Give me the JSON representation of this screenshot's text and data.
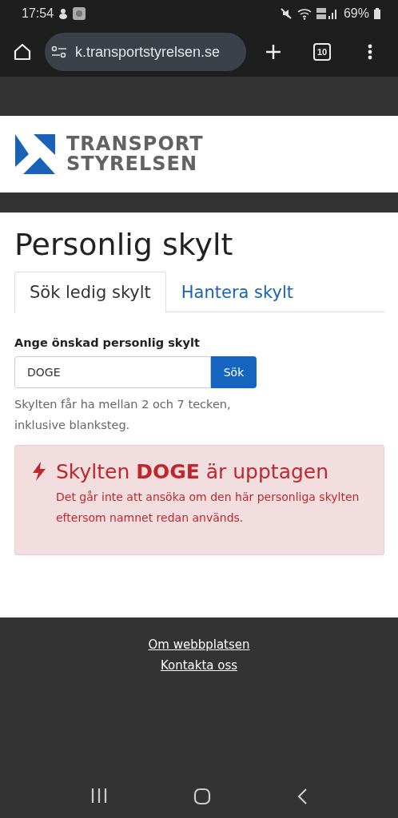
{
  "status_bar": {
    "time": "17:54",
    "battery": "69%"
  },
  "browser": {
    "url": "k.transportstyrelsen.se",
    "tab_count": "10"
  },
  "logo": {
    "line_1": "TRANSPORT",
    "line_2": "STYRELSEN"
  },
  "page": {
    "title": "Personlig skylt"
  },
  "tabs": [
    {
      "label": "Sök ledig skylt",
      "selected": true
    },
    {
      "label": "Hantera skylt",
      "selected": false
    }
  ],
  "form": {
    "label": "Ange önskad personlig skylt",
    "value": "DOGE",
    "button": "Sök",
    "hint": "Skylten får ha mellan 2 och 7 tecken, inklusive blanksteg."
  },
  "alert": {
    "title": "Skylten **DOGE** är upptagen",
    "message": "Det går inte att ansöka om den här personliga skylten eftersom namnet redan används."
  },
  "footer": {
    "links": [
      "Om webbplatsen",
      "Kontakta oss"
    ]
  }
}
